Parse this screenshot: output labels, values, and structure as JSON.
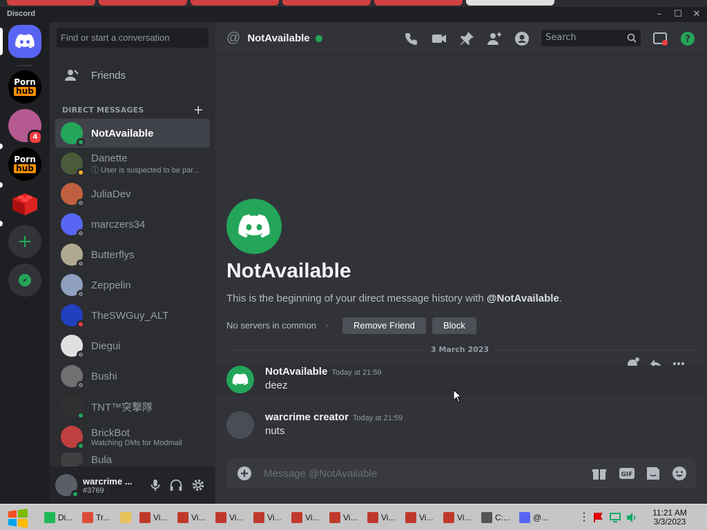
{
  "window": {
    "app_name": "Discord",
    "controls": [
      "–",
      "☐",
      "✕"
    ]
  },
  "sidebar": {
    "search_placeholder": "Find or start a conversation",
    "friends_label": "Friends",
    "dm_header": "DIRECT MESSAGES",
    "dms": [
      {
        "name": "NotAvailable",
        "sub": "",
        "status": "online",
        "active": true,
        "avatar_color": "#23a55a"
      },
      {
        "name": "Danette",
        "sub": "ⓘ User is suspected to be par...",
        "status": "idle",
        "active": false,
        "avatar_color": "#4a5a3a"
      },
      {
        "name": "JuliaDev",
        "sub": "",
        "status": "offline",
        "active": false,
        "avatar_color": "#c06040"
      },
      {
        "name": "marczers34",
        "sub": "",
        "status": "offline",
        "active": false,
        "avatar_color": "#5865f2"
      },
      {
        "name": "Butterflys",
        "sub": "",
        "status": "offline",
        "active": false,
        "avatar_color": "#b0a890"
      },
      {
        "name": "Zeppelin",
        "sub": "",
        "status": "offline",
        "active": false,
        "avatar_color": "#8fa0c0"
      },
      {
        "name": "TheSWGuy_ALT",
        "sub": "",
        "status": "dnd",
        "active": false,
        "avatar_color": "#2040c0"
      },
      {
        "name": "Diegui",
        "sub": "",
        "status": "offline",
        "active": false,
        "avatar_color": "#e0e0e0"
      },
      {
        "name": "Bushi",
        "sub": "",
        "status": "offline",
        "active": false,
        "avatar_color": "#707070"
      },
      {
        "name": "TNT™突撃隊",
        "sub": "",
        "status": "mobile",
        "active": false,
        "avatar_color": "#303030"
      },
      {
        "name": "BrickBot",
        "sub": "Watching DMs for Modmail",
        "status": "online",
        "active": false,
        "avatar_color": "#c04040"
      },
      {
        "name": "Bula",
        "sub": "",
        "status": "offline",
        "active": false,
        "avatar_color": "#404040"
      }
    ]
  },
  "servers": [
    {
      "label": "",
      "color": "#5865f2"
    },
    {
      "label": "Porn hub",
      "color": "#000000"
    },
    {
      "label": "",
      "color": "#c060a0",
      "badge": "4"
    },
    {
      "label": "Porn hub",
      "color": "#000000"
    },
    {
      "label": "",
      "color": "#d03030"
    }
  ],
  "user": {
    "name": "warcrime ...",
    "tag": "#3769"
  },
  "header": {
    "title": "NotAvailable",
    "search_placeholder": "Search"
  },
  "intro": {
    "name": "NotAvailable",
    "desc_prefix": "This is the beginning of your direct message history with ",
    "desc_handle": "@NotAvailable",
    "desc_suffix": ".",
    "mutual": "No servers in common",
    "remove_friend": "Remove Friend",
    "block": "Block"
  },
  "date_divider": "3 March 2023",
  "messages": [
    {
      "author": "NotAvailable",
      "time": "Today at 21:59",
      "content": "deez"
    },
    {
      "author": "warcrime creator",
      "time": "Today at 21:59",
      "content": "nuts"
    }
  ],
  "composer": {
    "placeholder": "Message @NotAvailable"
  },
  "taskbar": {
    "items": [
      "Di...",
      "Tr...",
      "",
      "Vi...",
      "Vi...",
      "Vi...",
      "Vi...",
      "Vi...",
      "Vi...",
      "Vi...",
      "Vi...",
      "Vi...",
      "C:...",
      "@..."
    ],
    "clock_time": "11:21 AM",
    "clock_date": "3/3/2023"
  }
}
